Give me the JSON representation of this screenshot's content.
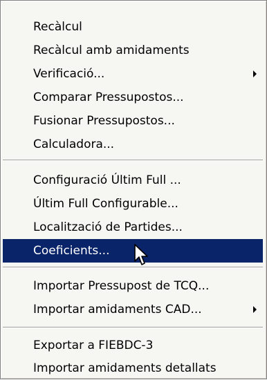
{
  "menu": {
    "items": [
      {
        "label": "Recàlcul"
      },
      {
        "label": "Recàlcul amb amidaments"
      },
      {
        "label": "Verificació...",
        "has_submenu": true
      },
      {
        "label": "Comparar Pressupostos..."
      },
      {
        "label": "Fusionar Pressupostos..."
      },
      {
        "label": "Calculadora..."
      },
      {
        "label": "Configuració Últim Full ..."
      },
      {
        "label": "Últim Full Configurable..."
      },
      {
        "label": "Localització de Partides..."
      },
      {
        "label": "Coeficients...",
        "selected": true
      },
      {
        "label": "Importar Pressupost de TCQ..."
      },
      {
        "label": "Importar amidaments CAD...",
        "has_submenu": true
      },
      {
        "label": "Exportar a FIEBDC-3"
      },
      {
        "label": "Importar amidaments detallats"
      }
    ]
  },
  "colors": {
    "menu_background": "#f6f6f3",
    "selection_background": "#0a246a",
    "selection_text": "#ffffff"
  },
  "icons": {
    "submenu_arrow": "chevron-right-icon",
    "cursor": "mouse-pointer-icon"
  }
}
